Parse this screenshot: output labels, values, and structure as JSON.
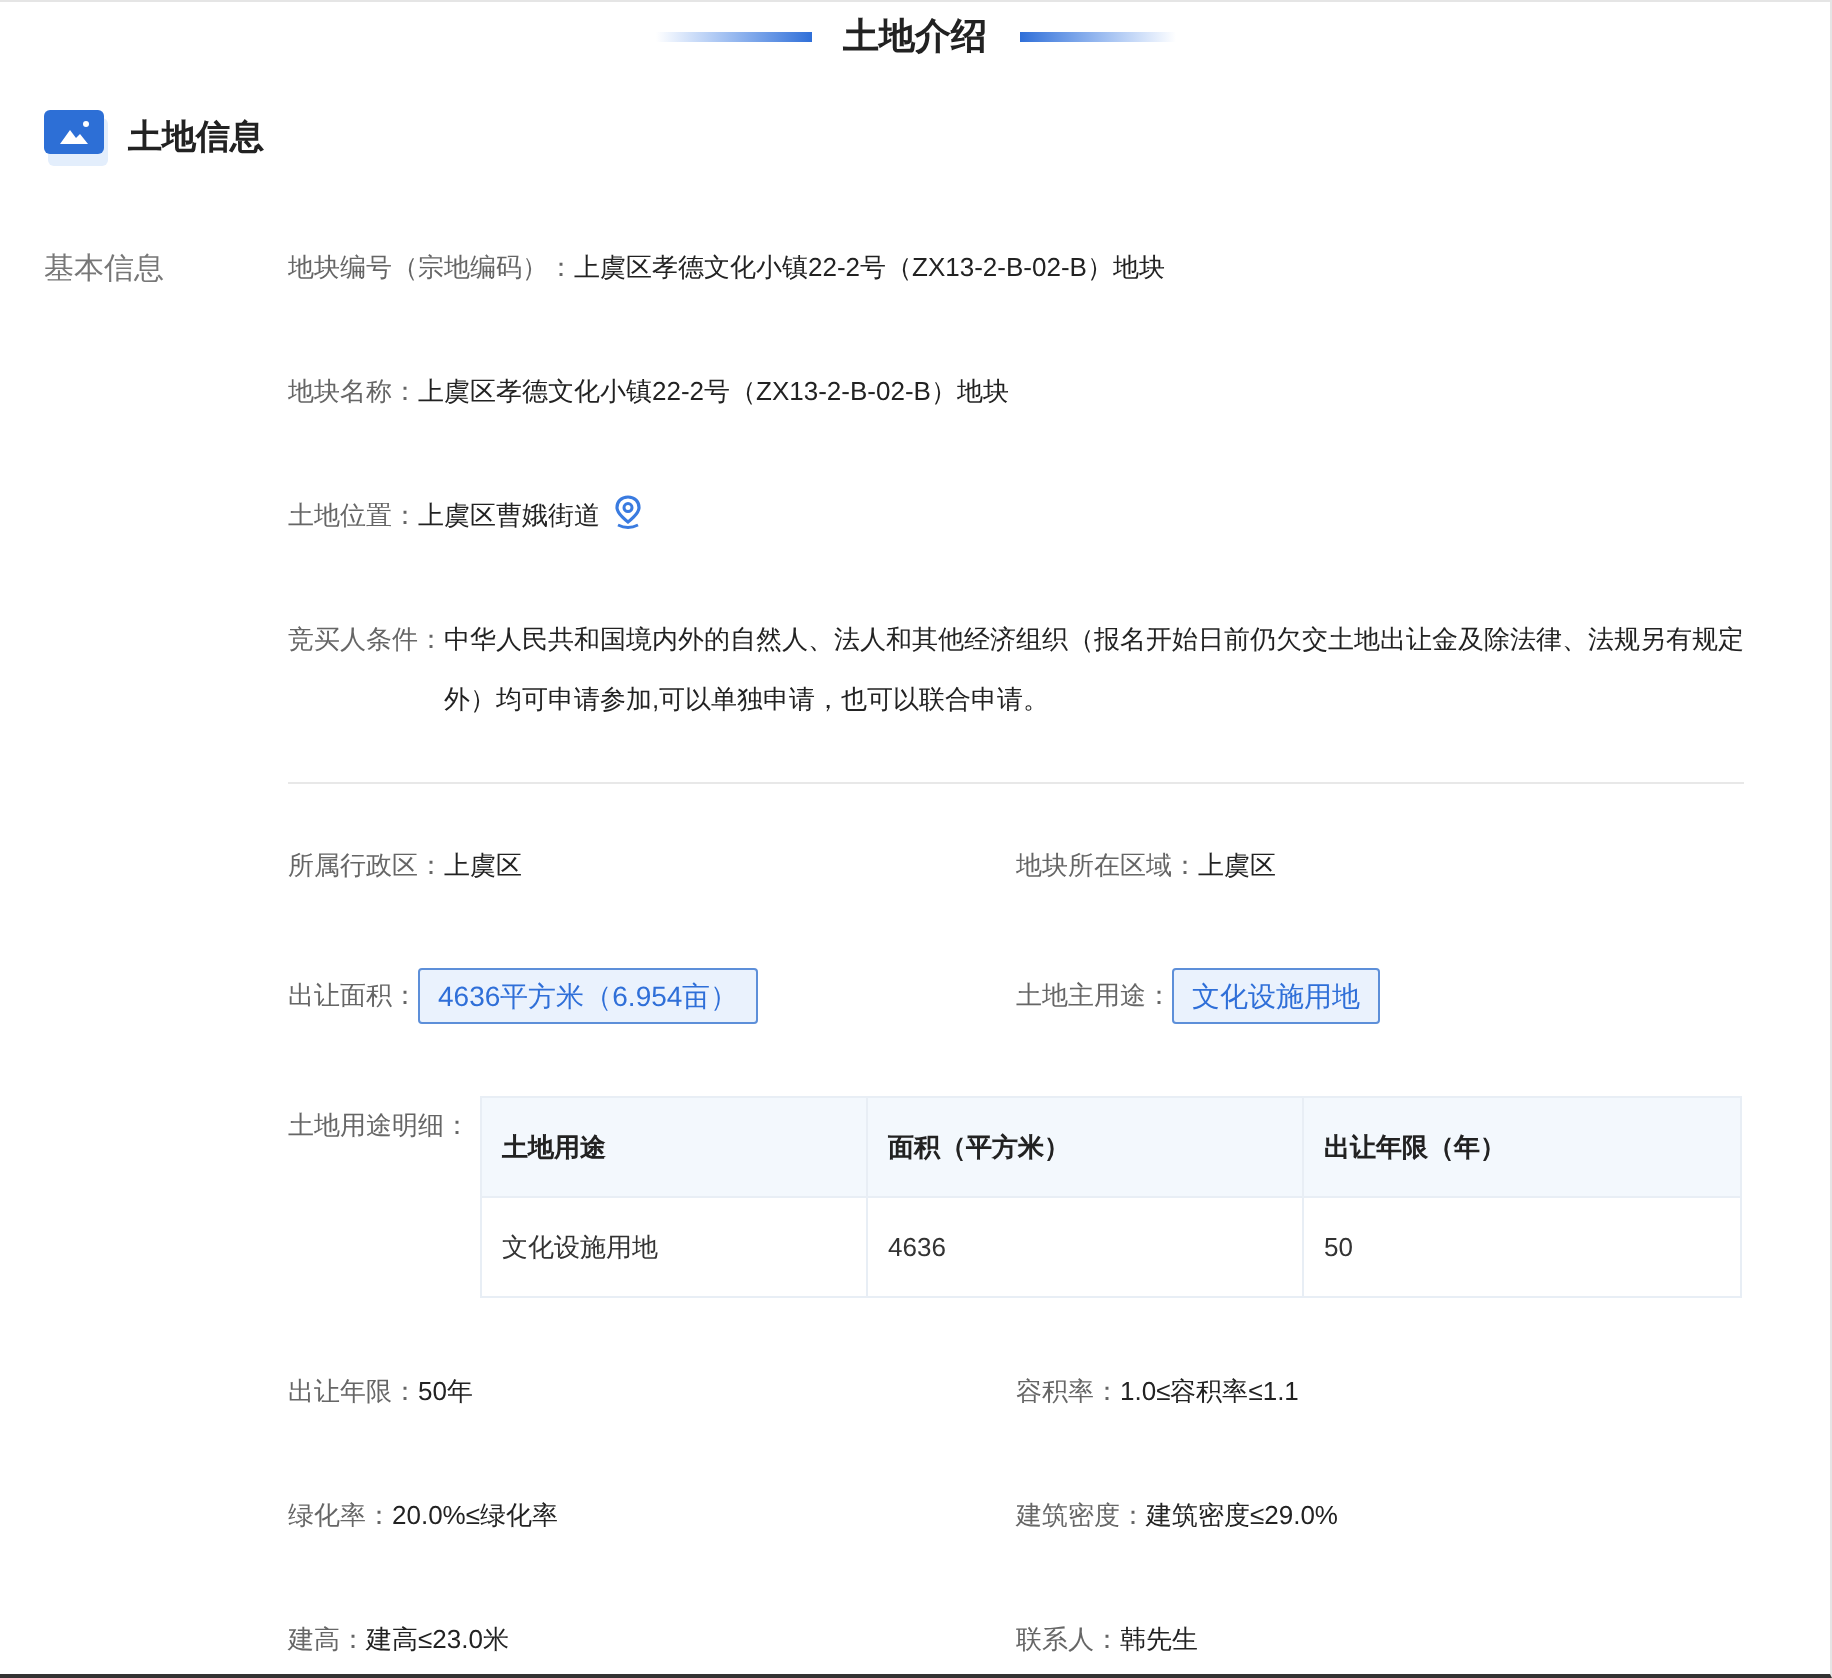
{
  "page_title": "土地介绍",
  "section": {
    "title": "土地信息"
  },
  "group_label": "基本信息",
  "details": [
    {
      "label": "地块编号（宗地编码）：",
      "value": "上虞区孝德文化小镇22-2号（ZX13-2-B-02-B）地块",
      "kind": "text"
    },
    {
      "label": "地块名称：",
      "value": "上虞区孝德文化小镇22-2号（ZX13-2-B-02-B）地块",
      "kind": "text"
    },
    {
      "label": "土地位置：",
      "value": "上虞区曹娥街道",
      "kind": "location"
    },
    {
      "label": "竞买人条件：",
      "value": "中华人民共和国境内外的自然人、法人和其他经济组织（报名开始日前仍欠交土地出让金及除法律、法规另有规定外）均可申请参加,可以单独申请，也可以联合申请。",
      "kind": "text"
    }
  ],
  "attributes_top": [
    {
      "label": "所属行政区：",
      "value": "上虞区",
      "kind": "text"
    },
    {
      "label": "地块所在区域：",
      "value": "上虞区",
      "kind": "text"
    },
    {
      "label": "出让面积：",
      "value": "4636平方米（6.954亩）",
      "kind": "tag"
    },
    {
      "label": "土地主用途：",
      "value": "文化设施用地",
      "kind": "tag"
    }
  ],
  "land_use_table": {
    "label": "土地用途明细：",
    "columns": [
      "土地用途",
      "面积（平方米）",
      "出让年限（年）"
    ],
    "rows": [
      [
        "文化设施用地",
        "4636",
        "50"
      ]
    ]
  },
  "attributes_bottom": [
    {
      "label": "出让年限：",
      "value": "50年",
      "kind": "text"
    },
    {
      "label": "容积率：",
      "value": "1.0≤容积率≤1.1",
      "kind": "text"
    },
    {
      "label": "绿化率：",
      "value": "20.0%≤绿化率",
      "kind": "text"
    },
    {
      "label": "建筑密度：",
      "value": "建筑密度≤29.0%",
      "kind": "text"
    },
    {
      "label": "建高：",
      "value": "建高≤23.0米",
      "kind": "text"
    },
    {
      "label": "联系人：",
      "value": "韩先生",
      "kind": "text"
    }
  ]
}
